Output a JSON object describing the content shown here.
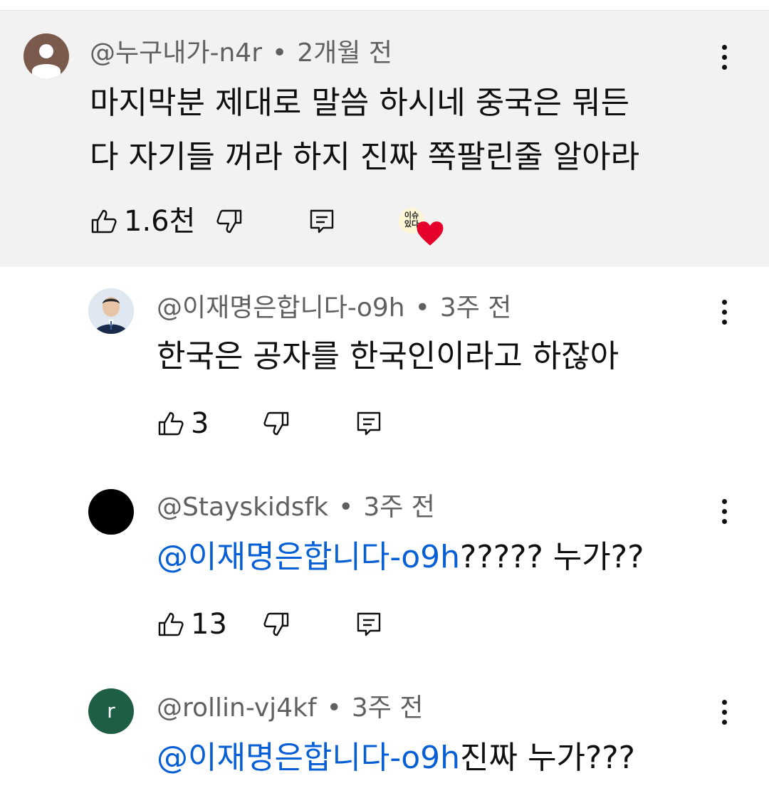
{
  "comments": [
    {
      "author": "@누구내가-n4r",
      "time": "2개월 전",
      "line1": "마지막분 제대로 말씀 하시네 중국은 뭐든",
      "line2": "다 자기들 꺼라 하지 진짜 쪽팔린줄 알아라",
      "likes": "1.6천",
      "creator_heart_text1": "이슈",
      "creator_heart_text2": "있다"
    },
    {
      "author": "@이재명은합니다-o9h",
      "time": "3주 전",
      "text": "한국은 공자를 한국인이라고 하잖아",
      "likes": "3"
    },
    {
      "author": "@Stayskidsfk",
      "time": "3주 전",
      "mention": "@이재명은합니다-o9h",
      "text": "????? 누가??",
      "likes": "13"
    },
    {
      "author": "@rollin-vj4kf",
      "avatar_letter": "r",
      "time": "3주 전",
      "mention": "@이재명은합니다-o9h",
      "text": "진짜 누가???"
    }
  ],
  "colors": {
    "highlight_bg": "#f2f2f2",
    "mention": "#065fd4",
    "meta": "#606060",
    "avatar_green": "#1e5e45",
    "heart": "#e4002b"
  }
}
